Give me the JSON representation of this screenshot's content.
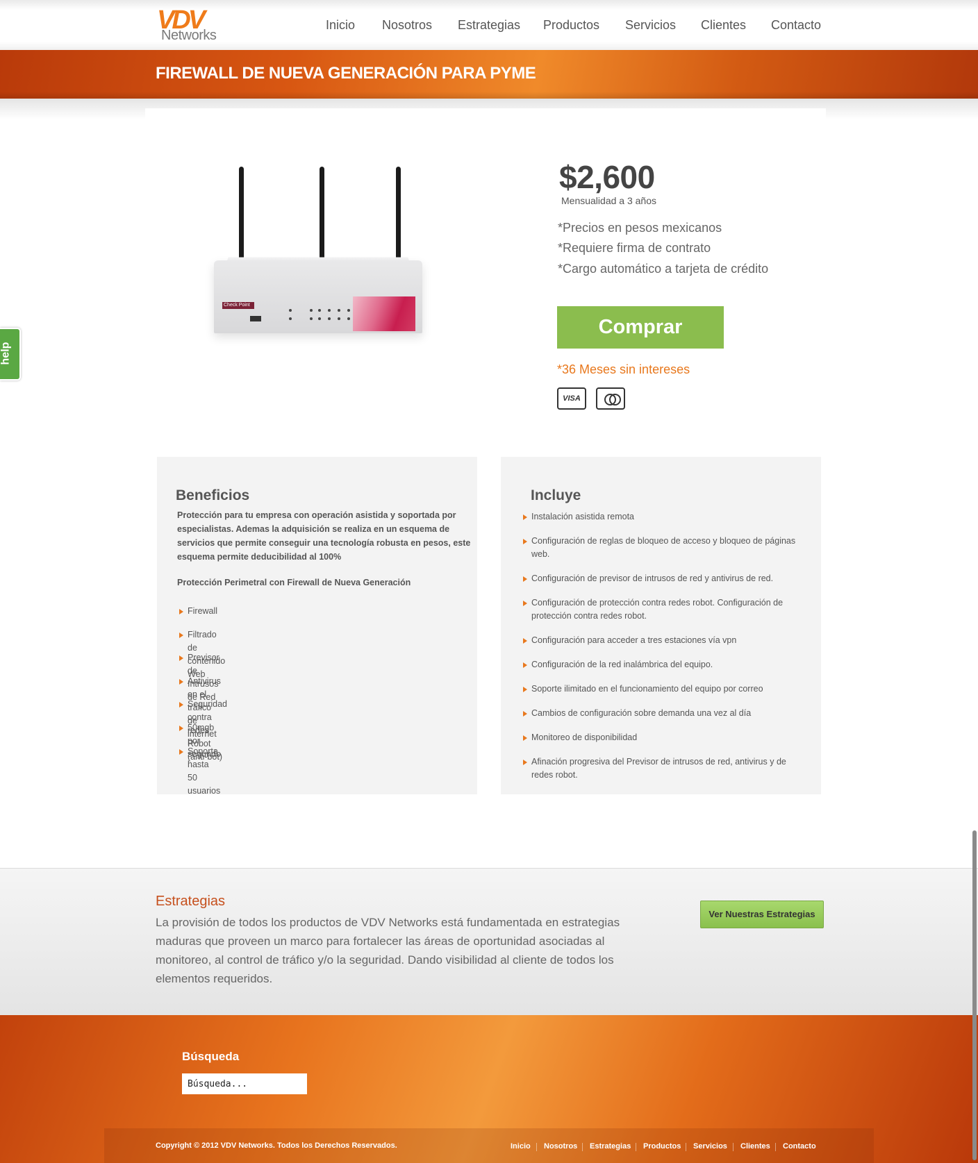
{
  "header": {
    "logo_main": "VDV",
    "logo_sub": "Networks",
    "nav": [
      "Inicio",
      "Nosotros",
      "Estrategias",
      "Productos",
      "Servicios",
      "Clientes",
      "Contacto"
    ]
  },
  "page_title": "FIREWALL DE NUEVA GENERACIÓN PARA PYME",
  "product": {
    "image_badge": "Check Point",
    "price": "$2,600",
    "price_note": "Mensualidad a 3 años",
    "notes": [
      "*Precios en pesos mexicanos",
      "*Requiere firma de contrato",
      "*Cargo automático a tarjeta de crédito"
    ],
    "buy_label": "Comprar",
    "msi": "*36 Meses sin intereses",
    "cards": [
      "VISA",
      "mastercard-icon"
    ]
  },
  "beneficios": {
    "title": "Beneficios",
    "intro": "Protección para tu empresa con operación asistida y soportada por especialistas. Ademas la adquisición se realiza en un esquema de servicios que permite conseguir una tecnología robusta en pesos, este esquema permite deducibilidad al 100%",
    "subtitle": "Protección Perimetral con Firewall de Nueva Generación",
    "items": [
      "Firewall",
      "Filtrado de contenido Web",
      "Previsor de Intrusos de Red",
      "Antivirus en el tráfico de internet",
      "Seguridad contra redes Robot (anti-bot)",
      "50mgb por segundo",
      "Soporta hasta 50 usuarios"
    ]
  },
  "incluye": {
    "title": "Incluye",
    "items": [
      "Instalación asistida remota",
      "Configuración de reglas de bloqueo de acceso y bloqueo de páginas web.",
      "Configuración de previsor de intrusos de red y antivirus de red.",
      "Configuración de protección contra redes robot. Configuración de protección contra redes robot.",
      "Configuración para acceder a tres estaciones vía vpn",
      "Configuración de la red inalámbrica del equipo.",
      "Soporte ilimitado en el funcionamiento del equipo por  correo",
      "Cambios de configuración sobre demanda una vez al día",
      "Monitoreo de disponibilidad",
      "Afinación progresiva del Previsor de intrusos de red, antivirus y de redes robot."
    ]
  },
  "estrategias": {
    "title": "Estrategias",
    "text": "La provisión de todos los productos de VDV Networks está fundamentada en estrategias maduras que proveen un marco para fortalecer las áreas de oportunidad asociadas al monitoreo, al control de tráfico y/o la seguridad. Dando visibilidad al cliente de todos los elementos requeridos.",
    "button": "Ver Nuestras Estrategias"
  },
  "footer": {
    "search_title": "Búsqueda",
    "search_placeholder": "Búsqueda...",
    "copyright": "Copyright © 2012 VDV Networks. Todos los Derechos Reservados.",
    "nav": [
      "Inicio",
      "Nosotros",
      "Estrategias",
      "Productos",
      "Servicios",
      "Clientes",
      "Contacto"
    ]
  },
  "help_label": "help",
  "colors": {
    "accent": "#e8781d",
    "buy": "#8bbd4e",
    "title_band": "#d85712"
  }
}
